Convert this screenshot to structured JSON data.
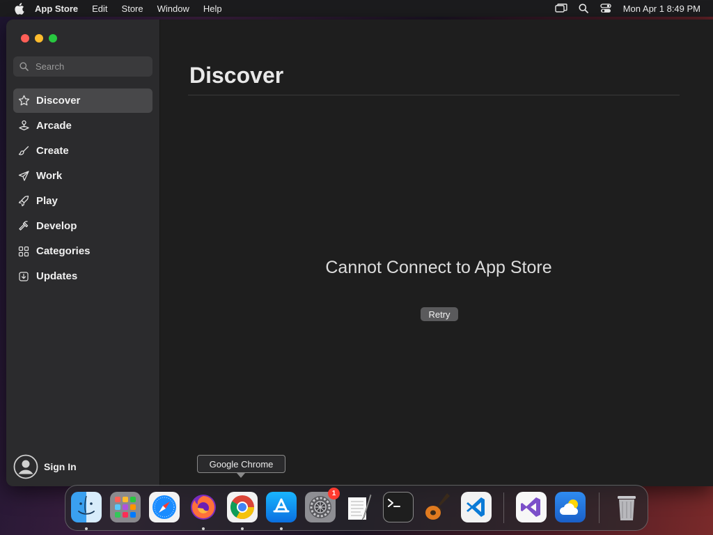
{
  "menubar": {
    "app_name": "App Store",
    "items": [
      "Edit",
      "Store",
      "Window",
      "Help"
    ],
    "clock": "Mon Apr 1  8:49 PM",
    "icons": [
      "apple-logo-icon",
      "screen-mirroring-icon",
      "spotlight-search-icon",
      "control-center-icon"
    ]
  },
  "sidebar": {
    "search_placeholder": "Search",
    "items": [
      {
        "label": "Discover",
        "icon": "star-icon",
        "active": true
      },
      {
        "label": "Arcade",
        "icon": "joystick-icon"
      },
      {
        "label": "Create",
        "icon": "brush-icon"
      },
      {
        "label": "Work",
        "icon": "paper-plane-icon"
      },
      {
        "label": "Play",
        "icon": "rocket-icon"
      },
      {
        "label": "Develop",
        "icon": "hammer-icon"
      },
      {
        "label": "Categories",
        "icon": "grid-icon"
      },
      {
        "label": "Updates",
        "icon": "download-icon"
      }
    ],
    "sign_in": "Sign In"
  },
  "main": {
    "title": "Discover",
    "error_message": "Cannot Connect to App Store",
    "retry_label": "Retry"
  },
  "dock": {
    "tooltip": "Google Chrome",
    "apps": [
      {
        "name": "Finder",
        "icon": "finder-icon",
        "running": true
      },
      {
        "name": "Launchpad",
        "icon": "launchpad-icon",
        "running": false
      },
      {
        "name": "Safari",
        "icon": "safari-icon",
        "running": false
      },
      {
        "name": "Firefox",
        "icon": "firefox-icon",
        "running": true
      },
      {
        "name": "Google Chrome",
        "icon": "chrome-icon",
        "running": true
      },
      {
        "name": "App Store",
        "icon": "app-store-icon",
        "running": true
      },
      {
        "name": "System Settings",
        "icon": "settings-icon",
        "running": false,
        "badge": "1"
      },
      {
        "name": "TextEdit",
        "icon": "textedit-icon",
        "running": false
      },
      {
        "name": "Terminal",
        "icon": "terminal-icon",
        "running": false
      },
      {
        "name": "GarageBand",
        "icon": "garageband-icon",
        "running": false
      },
      {
        "name": "Visual Studio Code",
        "icon": "vscode-icon",
        "running": false
      },
      {
        "name": "Visual Studio",
        "icon": "visual-studio-icon",
        "running": false
      },
      {
        "name": "Weather",
        "icon": "weather-icon",
        "running": false
      },
      {
        "name": "Trash",
        "icon": "trash-icon",
        "running": false
      }
    ]
  }
}
